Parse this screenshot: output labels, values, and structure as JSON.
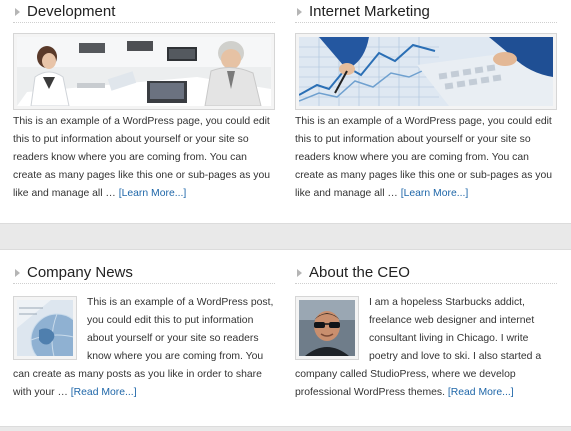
{
  "columns_top": [
    {
      "title": "Development",
      "text": "This is an example of a WordPress page, you could edit this to put information about yourself or your site so readers know where you are coming from. You can create as many pages like this one or sub-pages as you like and manage all …",
      "more": "[Learn More...]"
    },
    {
      "title": "Internet Marketing",
      "text": "This is an example of a WordPress page, you could edit this to put information about yourself or your site so readers know where you are coming from. You can create as many pages like this one or sub-pages as you like and manage all …",
      "more": "[Learn More...]"
    }
  ],
  "columns_bottom": [
    {
      "title": "Company News",
      "text": "This is an example of a WordPress post, you could edit this to put information about yourself or your site so readers know where you are coming from. You can create as many posts as you like in order to share with your …",
      "more": "[Read More...]"
    },
    {
      "title": "About the CEO",
      "text": "I am a hopeless Starbucks addict, freelance web designer and internet consultant living in Chicago. I write poetry and love to ski. I also started a company called StudioPress, where we develop professional WordPress themes.",
      "more": "[Read More...]"
    }
  ],
  "colors": {
    "link": "#1e66a8",
    "panel_bg": "#ffffff",
    "page_bg": "#e9e9e9"
  },
  "icons": [
    "arrow-bullet-icon"
  ]
}
